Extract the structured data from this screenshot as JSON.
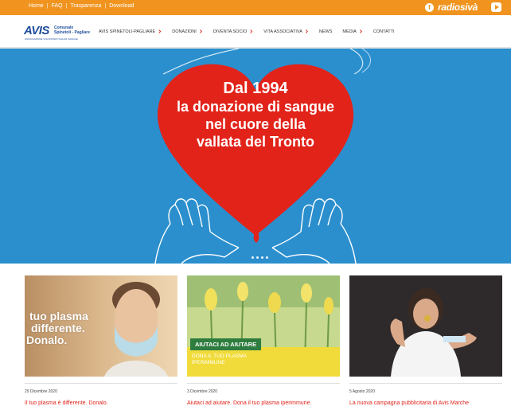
{
  "topbar": {
    "links": [
      "Home",
      "FAQ",
      "Trasparenza",
      "Download"
    ],
    "radio_logo": "radiosivà",
    "colors": {
      "bar": "#f0941f"
    },
    "icons": [
      "facebook-icon",
      "youtube-icon"
    ]
  },
  "logo": {
    "main": "AVIS",
    "line1": "Comunale",
    "line2": "Spinetoli - Pagliare",
    "tagline": "ASSOCIAZIONE VOLONTARI ITALIANI SANGUE"
  },
  "nav": {
    "items": [
      {
        "label": "AVIS SPINETOLI-PAGLIARE",
        "dropdown": true
      },
      {
        "label": "DONAZIONI",
        "dropdown": true
      },
      {
        "label": "DIVENTA SOCIO",
        "dropdown": true
      },
      {
        "label": "VITA ASSOCIATIVA",
        "dropdown": true
      },
      {
        "label": "NEWS",
        "dropdown": false
      },
      {
        "label": "MEDIA",
        "dropdown": true
      },
      {
        "label": "CONTATTI",
        "dropdown": false
      }
    ]
  },
  "hero": {
    "line1": "Dal 1994",
    "line2": "la donazione di sangue",
    "line3": "nel cuore della",
    "line4": "vallata del Tronto",
    "colors": {
      "background": "#2b8fce",
      "heart": "#e2231a"
    },
    "slides": 4
  },
  "cards": [
    {
      "image_text_1": "tuo plasma",
      "image_text_2": "differente.",
      "image_text_3": "Donalo.",
      "date": "29 Dicembre 2020",
      "title": "Il tuo plasma è differente. Donalo."
    },
    {
      "image_text_1": "AIUTACI AD AIUTARE",
      "image_text_2": "DONA IL TUO PLASMA",
      "image_text_3": "IPERIMMUNE",
      "date": "3 Dicembre 2020",
      "title": "Aiutaci ad aiutare. Dona il tuo plasma iperimmune."
    },
    {
      "date": "5 Agosto 2020",
      "title": "La nuova campagna pubblicitaria di Avis Marche"
    }
  ],
  "accent_color": "#e2231a"
}
